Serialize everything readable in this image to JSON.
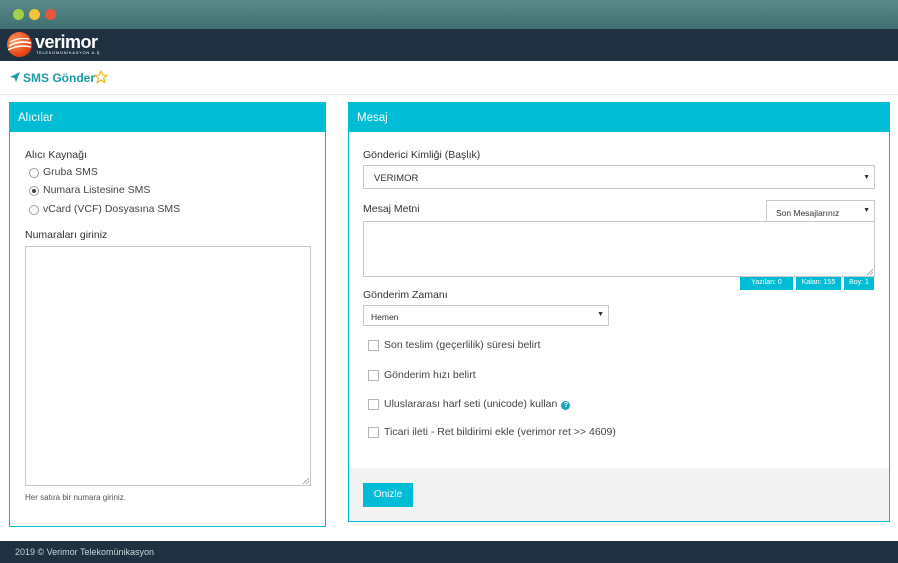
{
  "brand": {
    "name": "verimor",
    "tagline": "TELEKOMÜNİKASYON A.Ş."
  },
  "page": {
    "title": "SMS Gönder"
  },
  "recipients": {
    "heading": "Alıcılar",
    "source_label": "Alıcı Kaynağı",
    "options": [
      {
        "label": "Gruba SMS",
        "selected": false
      },
      {
        "label": "Numara Listesine SMS",
        "selected": true
      },
      {
        "label": "vCard (VCF) Dosyasına SMS",
        "selected": false
      }
    ],
    "numbers_label": "Numaraları giriniz",
    "numbers_value": "",
    "hint": "Her satıra bir numara giriniz."
  },
  "message": {
    "heading": "Mesaj",
    "sender_label": "Gönderici Kimliği (Başlık)",
    "sender_value": "VERIMOR",
    "text_label": "Mesaj Metni",
    "last_messages": "Son Mesajlarınız",
    "text_value": "",
    "counters": {
      "written": "Yazılan: 0",
      "remaining": "Kalan: 155",
      "size": "Boy: 1"
    },
    "time_label": "Gönderim Zamanı",
    "time_value": "Hemen",
    "checkboxes": [
      {
        "label": "Son teslim (geçerlilik) süresi belirt",
        "checked": false
      },
      {
        "label": "Gönderim hızı belirt",
        "checked": false
      },
      {
        "label": "Uluslararası harf seti (unicode) kullan",
        "checked": false,
        "help": true
      },
      {
        "label": "Ticari ileti - Ret bildirimi ekle (verimor ret >> 4609)",
        "checked": false
      }
    ],
    "preview_button": "Onizle"
  },
  "footer": {
    "text": "2019 © Verimor Telekomünikasyon"
  },
  "colors": {
    "accent": "#00bcd4",
    "title": "#1a9aa8",
    "dark_bar": "#1f3040",
    "logo_orange": "#e8491d"
  }
}
